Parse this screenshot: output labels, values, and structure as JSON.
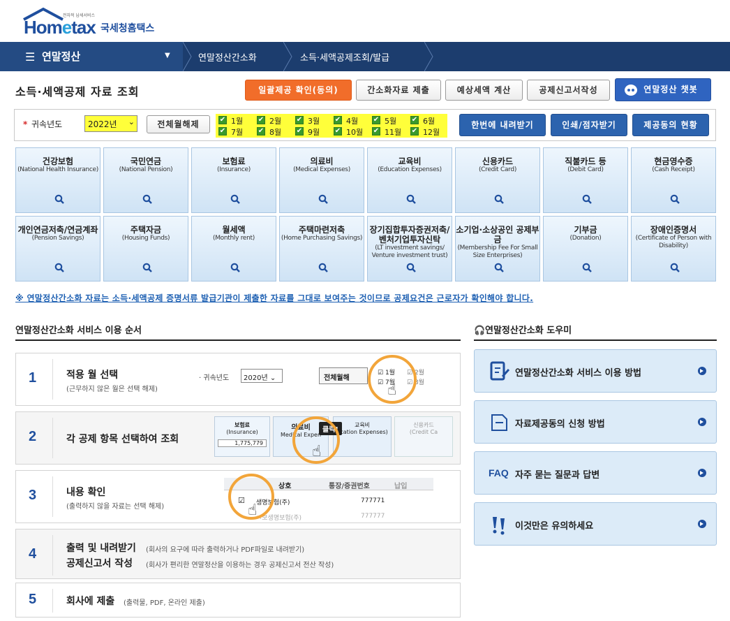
{
  "logo": {
    "tagline": "전자적 납세서비스",
    "word_a": "Hom",
    "word_b": "e",
    "word_c": "tax",
    "korean": "국세청홈택스"
  },
  "nav": {
    "menu_label": "연말정산",
    "crumb1": "연말정산간소화",
    "crumb2": "소득·세액공제조회/발급"
  },
  "page": {
    "title": "소득·세액공제 자료 조회"
  },
  "actions": {
    "consent": "일괄제공 확인(동의)",
    "submit": "간소화자료 제출",
    "estimate": "예상세액 계산",
    "report": "공제신고서작성",
    "chatbot": "연말정산 챗봇"
  },
  "filter": {
    "required_mark": "*",
    "year_label": "귀속년도",
    "year_value": "2022년",
    "clear_months": "전체월해제",
    "months": [
      "1월",
      "2월",
      "3월",
      "4월",
      "5월",
      "6월",
      "7월",
      "8월",
      "9월",
      "10월",
      "11월",
      "12월"
    ],
    "download": "한번에 내려받기",
    "print": "인쇄/점자받기",
    "providers": "제공동의 현황"
  },
  "categories": [
    {
      "ko": "건강보험",
      "en": "(National Health Insurance)"
    },
    {
      "ko": "국민연금",
      "en": "(National Pension)"
    },
    {
      "ko": "보험료",
      "en": "(Insurance)"
    },
    {
      "ko": "의료비",
      "en": "(Medical Expenses)"
    },
    {
      "ko": "교육비",
      "en": "(Education Expenses)"
    },
    {
      "ko": "신용카드",
      "en": "(Credit Card)"
    },
    {
      "ko": "직불카드 등",
      "en": "(Debit Card)"
    },
    {
      "ko": "현금영수증",
      "en": "(Cash Receipt)"
    },
    {
      "ko": "개인연금저축/연금계좌",
      "en": "(Pension Savings)"
    },
    {
      "ko": "주택자금",
      "en": "(Housing Funds)"
    },
    {
      "ko": "월세액",
      "en": "(Monthly rent)"
    },
    {
      "ko": "주택마련저축",
      "en": "(Home Purchasing Savings)"
    },
    {
      "ko": "장기집합투자증권저축/벤처기업투자신탁",
      "en": "(LT investment savings/ Venture investment trust)"
    },
    {
      "ko": "소기업·소상공인 공제부금",
      "en": "(Membership Fee For Small Size Enterprises)"
    },
    {
      "ko": "기부금",
      "en": "(Donation)"
    },
    {
      "ko": "장애인증명서",
      "en": "(Certificate of Person with Disability)"
    }
  ],
  "notice": "※ 연말정산간소화 자료는 소득·세액공제 증명서류 발급기관이 제출한 자료를 그대로 보여주는 것이므로 공제요건은 근로자가 확인해야 합니다.",
  "steps_title": "연말정산간소화 서비스 이용 순서",
  "steps": [
    {
      "num": "1",
      "title": "적용 월 선택",
      "sub": "(근무하지 않은 월은 선택 해제)"
    },
    {
      "num": "2",
      "title": "각 공제 항목 선택하여 조회",
      "sub": ""
    },
    {
      "num": "3",
      "title": "내용 확인",
      "sub": "(출력하지 않을 자료는 선택 해제)"
    },
    {
      "num": "4",
      "title": "출력 및 내려받기",
      "sub": "(회사의 요구에 따라 출력하거나 PDF파일로 내려받기)",
      "title2": "공제신고서 작성",
      "sub2": "(회사가 편리한 연말정산을 이용하는 경우 공제신고서 전산 작성)"
    },
    {
      "num": "5",
      "title": "회사에 제출",
      "sub": "(출력물, PDF, 온라인 제출)"
    }
  ],
  "illus": {
    "s1": {
      "label": "귀속년도",
      "year": "2020년",
      "clear": "전체월해",
      "m1": "1월",
      "m2": "2월",
      "m7": "7월",
      "m8": "8월"
    },
    "s2": {
      "c1": "보험료",
      "c1e": "(Insurance)",
      "c1v": "1,775,779",
      "c2": "의료비",
      "c2e": "Medical Expen",
      "c3": "교육비",
      "c3e": "ucation Expenses)",
      "c4": "신용카드",
      "c4e": "(Credit Ca",
      "click": "클릭!"
    },
    "s3": {
      "h1": "상호",
      "h2": "통장/증권번호",
      "h3": "납입",
      "r1a": "생명보험(주)",
      "r1b": "777771",
      "r2a": "ㄱ보생명보험(주)",
      "r2b": "777777"
    }
  },
  "helper_title": "연말정산간소화 도우미",
  "helpers": [
    {
      "label": "연말정산간소화 서비스 이용 방법",
      "icon": "document-pen-icon"
    },
    {
      "label": "자료제공동의 신청 방법",
      "icon": "document-icon"
    },
    {
      "label": "자주 묻는 질문과 답변",
      "icon": "faq-icon",
      "prefix": "FAQ"
    },
    {
      "label": "이것만은 유의하세요",
      "icon": "exclamation-icon"
    }
  ],
  "colors": {
    "nav": "#1c3d6e",
    "accent_orange": "#f16d2a",
    "brand_blue": "#1f4f9e",
    "highlight": "#ffff3a"
  }
}
